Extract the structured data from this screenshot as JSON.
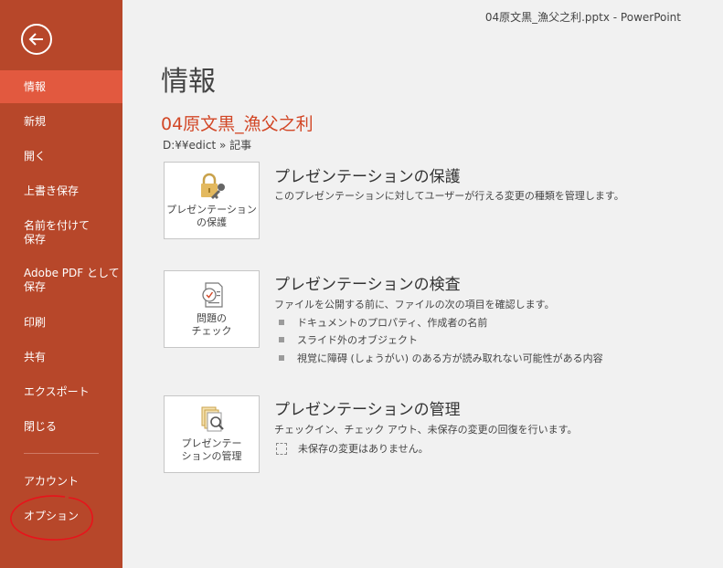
{
  "window": {
    "title": "04原文黒_漁父之利.pptx - PowerPoint"
  },
  "sidebar": {
    "items": [
      {
        "label": "情報",
        "active": true
      },
      {
        "label": "新規"
      },
      {
        "label": "開く"
      },
      {
        "label": "上書き保存"
      },
      {
        "label": "名前を付けて\n保存"
      },
      {
        "label": "Adobe PDF として\n保存"
      },
      {
        "label": "印刷"
      },
      {
        "label": "共有"
      },
      {
        "label": "エクスポート"
      },
      {
        "label": "閉じる"
      },
      {
        "label": "アカウント"
      },
      {
        "label": "オプション"
      }
    ]
  },
  "main": {
    "title": "情報",
    "doc_name": "04原文黒_漁父之利",
    "doc_path": "D:¥¥edict » 記事",
    "sections": [
      {
        "tile_label": "プレゼンテーション\nの保護",
        "tile_icon": "lock-key-icon",
        "title": "プレゼンテーションの保護",
        "desc": "このプレゼンテーションに対してユーザーが行える変更の種類を管理します。"
      },
      {
        "tile_label": "問題の\nチェック",
        "tile_icon": "checklist-icon",
        "title": "プレゼンテーションの検査",
        "desc": "ファイルを公開する前に、ファイルの次の項目を確認します。",
        "bullets": [
          "ドキュメントのプロパティ、作成者の名前",
          "スライド外のオブジェクト",
          "視覚に障碍 (しょうがい) のある方が読み取れない可能性がある内容"
        ]
      },
      {
        "tile_label": "プレゼンテー\nションの管理",
        "tile_icon": "manage-versions-icon",
        "title": "プレゼンテーションの管理",
        "desc": "チェックイン、チェック アウト、未保存の変更の回復を行います。",
        "status": "未保存の変更はありません。"
      }
    ]
  },
  "colors": {
    "sidebar": "#b7472a",
    "active": "#e2593f",
    "accent": "#d24726"
  }
}
